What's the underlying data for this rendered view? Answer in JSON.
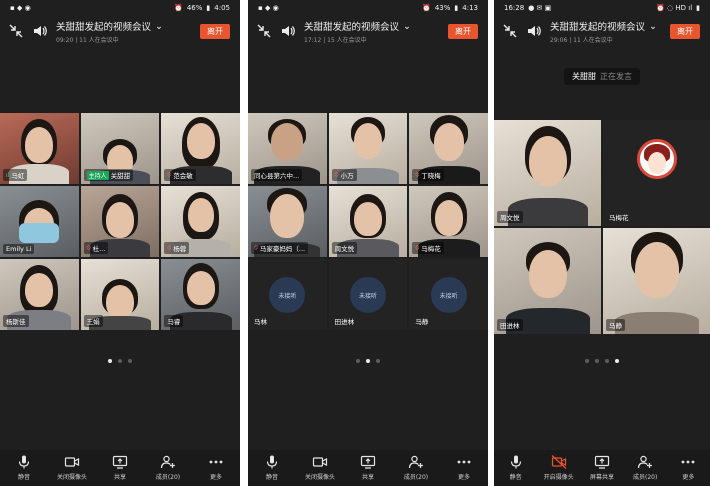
{
  "phones": [
    {
      "status": {
        "time": "4:05",
        "battery": "46%"
      },
      "meeting": {
        "title": "关甜甜发起的视频会议",
        "subtitle": "09:20 | 11 人在会议中",
        "leave_label": "离开"
      },
      "tiles": [
        {
          "name": "马虹",
          "mic": "on"
        },
        {
          "name": "关甜甜",
          "badge": "主持人"
        },
        {
          "name": "范会敏",
          "mic": "off"
        },
        {
          "name": "Emily Li"
        },
        {
          "name": "杜...",
          "mic": "off"
        },
        {
          "name": "杨蓉",
          "mic": "off"
        },
        {
          "name": "杨斯佳"
        },
        {
          "name": "王娟"
        },
        {
          "name": "马睿"
        }
      ],
      "page_dots": 3,
      "active_dot": 0,
      "toolbar": [
        "静音",
        "关闭摄像头",
        "共享",
        "成员(20)",
        "更多"
      ]
    },
    {
      "status": {
        "time": "4:13",
        "battery": "43%"
      },
      "meeting": {
        "title": "关甜甜发起的视频会议",
        "subtitle": "17:12 | 15 人在会议中",
        "leave_label": "离开"
      },
      "tiles": [
        {
          "name": "同心县第六中..."
        },
        {
          "name": "小万",
          "mic": "off"
        },
        {
          "name": "丁晓梅",
          "mic": "off"
        },
        {
          "name": "马家豪妈妈（...",
          "mic": "off"
        },
        {
          "name": "周文悦"
        },
        {
          "name": "马梅花",
          "mic": "off"
        },
        {
          "name": "马林",
          "not_joined": "未接听"
        },
        {
          "name": "田进林",
          "not_joined": "未接听"
        },
        {
          "name": "马静",
          "not_joined": "未接听"
        }
      ],
      "page_dots": 3,
      "active_dot": 1,
      "toolbar": [
        "静音",
        "关闭摄像头",
        "共享",
        "成员(20)",
        "更多"
      ]
    },
    {
      "status": {
        "time": "16:28",
        "battery": ""
      },
      "meeting": {
        "title": "关甜甜发起的视频会议",
        "subtitle": "29:06 | 11 人在会议中",
        "leave_label": "离开"
      },
      "speaking": {
        "who": "关甜甜",
        "verb": "正在发言"
      },
      "tiles": [
        {
          "name": "周文悦"
        },
        {
          "name": "马梅花",
          "avatar": "cartoon"
        },
        {
          "name": "田进林"
        },
        {
          "name": "马静"
        }
      ],
      "page_dots": 4,
      "active_dot": 3,
      "toolbar": [
        "静音",
        "开启摄像头",
        "屏幕共享",
        "成员(20)",
        "更多"
      ]
    }
  ],
  "colors": {
    "leave_button": "#e8552e",
    "host_badge": "#1aa659",
    "background": "#1f1f1f"
  }
}
